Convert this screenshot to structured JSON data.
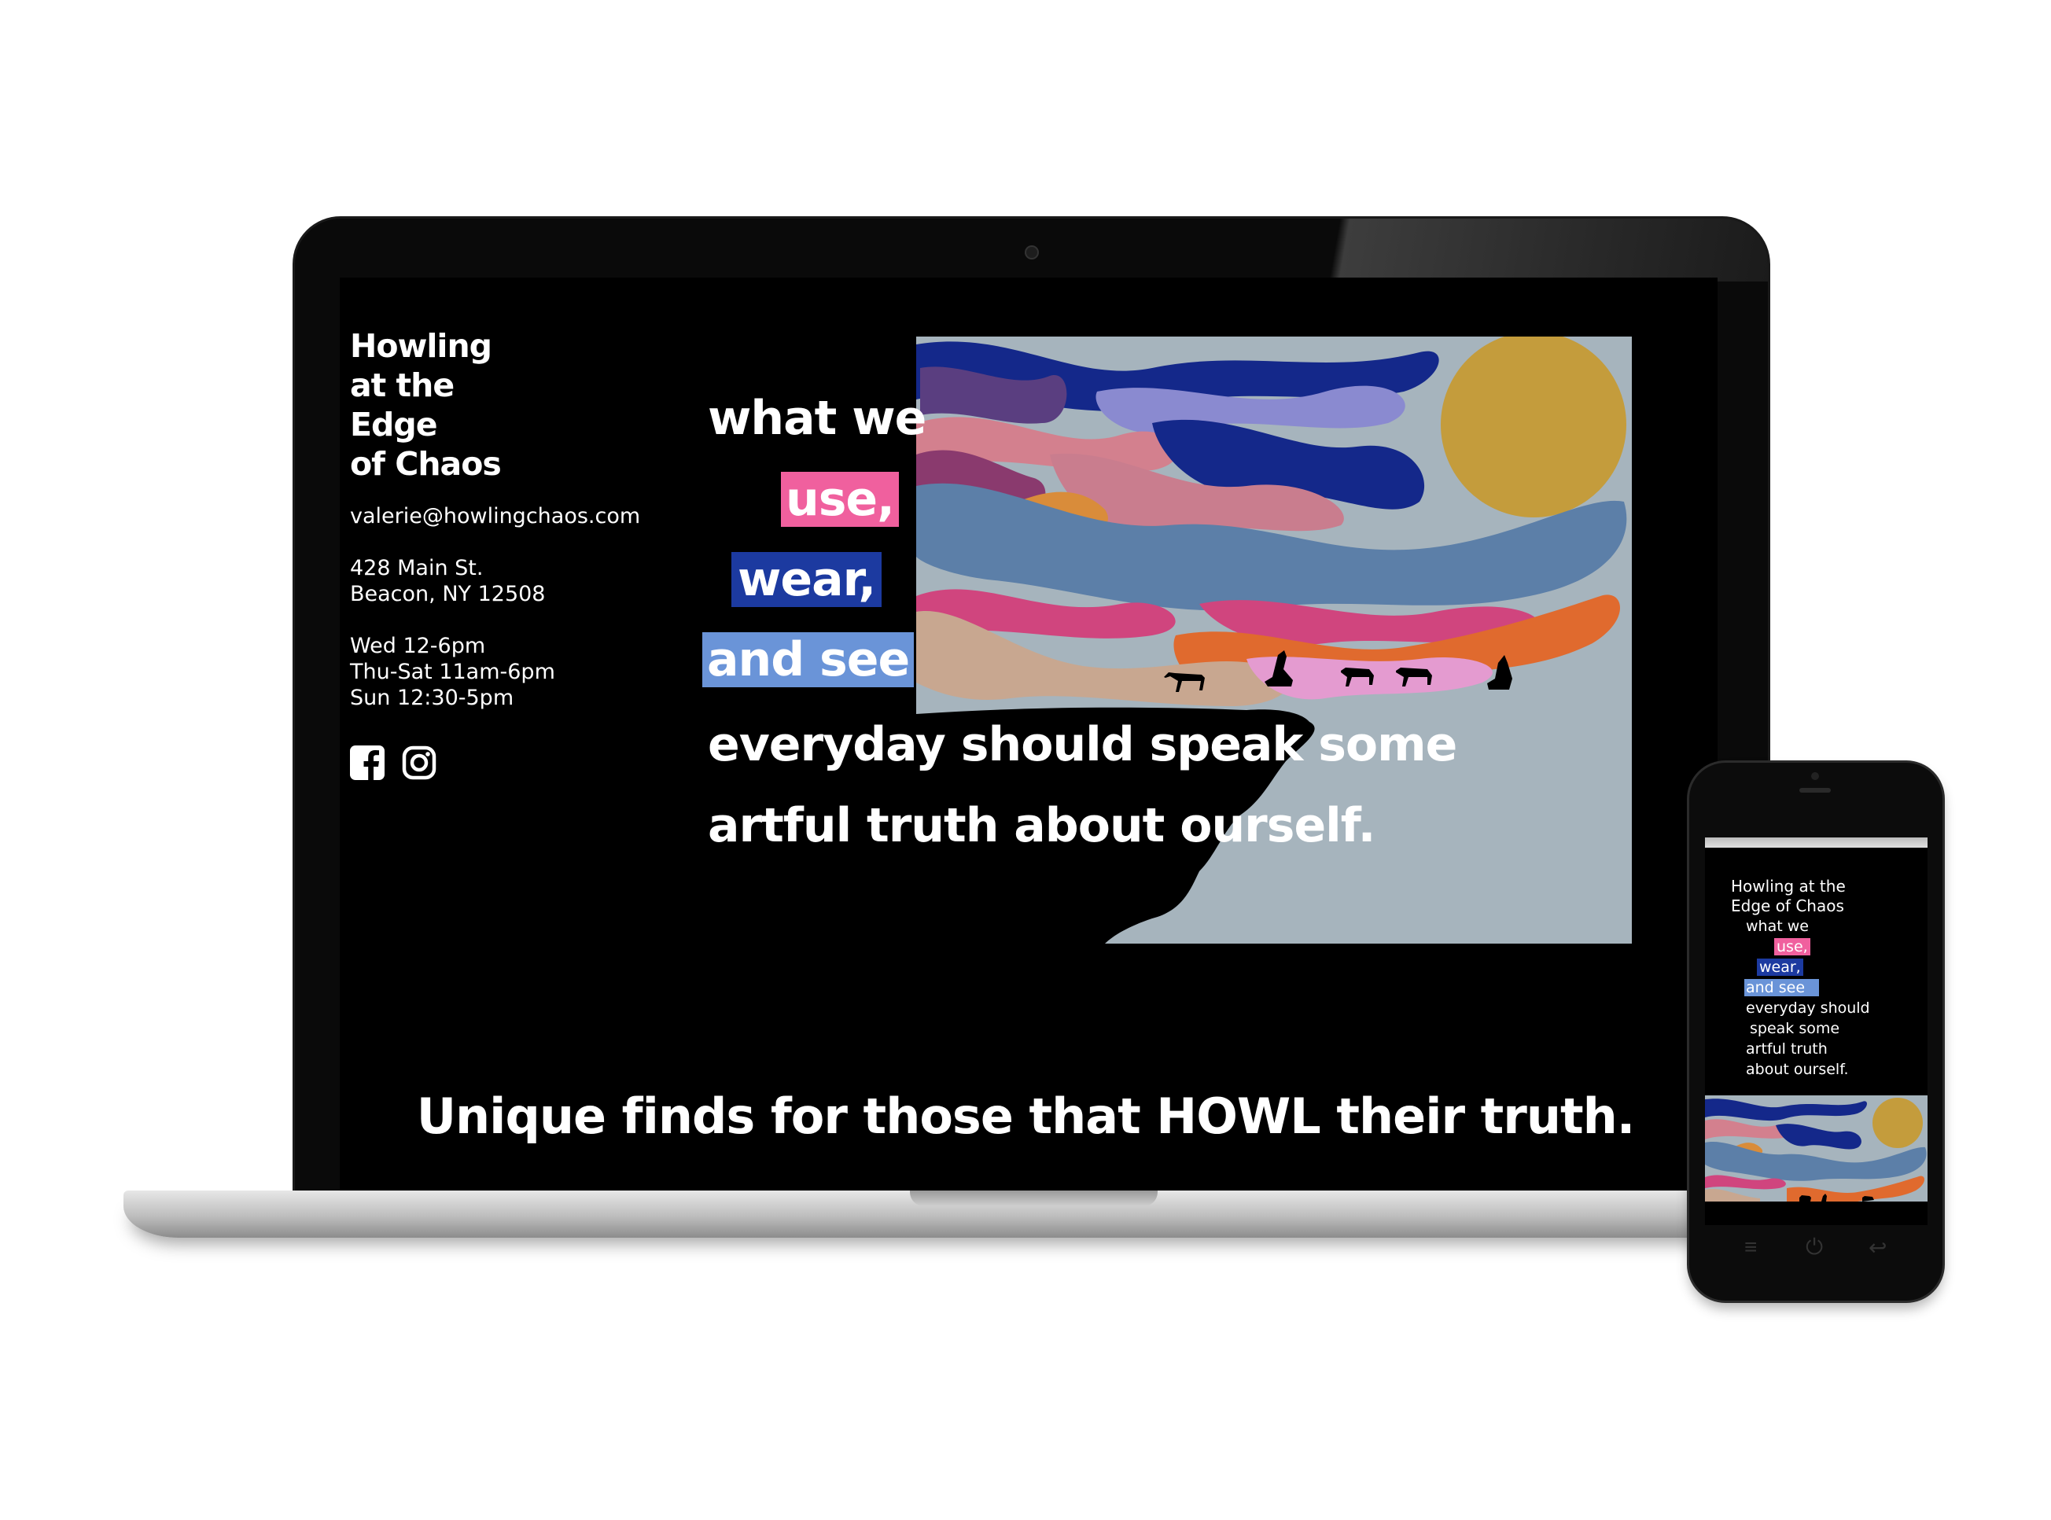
{
  "laptop": {
    "brand": {
      "line1": "Howling",
      "line2": "at the",
      "line3": "Edge",
      "line4": "of Chaos"
    },
    "email": "valerie@howlingchaos.com",
    "address": {
      "line1": "428 Main St.",
      "line2": "Beacon, NY 12508"
    },
    "hours": {
      "line1": "Wed 12-6pm",
      "line2": "Thu-Sat 11am-6pm",
      "line3": "Sun 12:30-5pm"
    },
    "social_icons": [
      "facebook-icon",
      "instagram-icon"
    ],
    "headline": {
      "line1": "what we",
      "use": "use,",
      "wear": "wear,",
      "see": "and see",
      "line5": "everyday should speak some",
      "line6": "artful truth about ourself."
    },
    "tagline": "Unique finds for those that HOWL their truth."
  },
  "phone": {
    "brand": {
      "line1": "Howling at the",
      "line2": "Edge of Chaos"
    },
    "headline": {
      "line1": "what we",
      "use": "use,",
      "wear": "wear,",
      "see": "and see",
      "line5": "everyday should",
      "line6": "speak some",
      "line7": "artful truth",
      "line8": "about ourself."
    }
  },
  "colors": {
    "pink": "#f0609e",
    "navy": "#1c3aa0",
    "light_blue": "#6a94d8",
    "art_background": "#a6b4bd",
    "sun": "#c49c3c"
  }
}
